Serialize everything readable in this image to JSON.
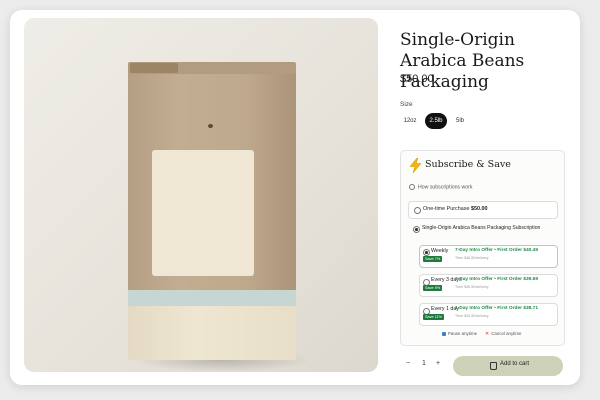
{
  "product": {
    "title": "Single-Origin Arabica Beans Packaging",
    "price": "$50.00"
  },
  "size": {
    "label": "Size",
    "options": [
      "12oz",
      "2.5lb",
      "5lb"
    ],
    "selected": "2.5lb"
  },
  "subscription": {
    "title": "Subscribe & Save",
    "how_link": "How subscriptions work",
    "one_time": {
      "label": "One-time Purchase",
      "price": "$50.00"
    },
    "subscribe_option": "Single-Origin Arabica Beans Packaging Subscription",
    "frequencies": [
      {
        "name": "Weekly",
        "badge": "Save 7%",
        "offer": "7-Day Intro Offer • First Order $40.45",
        "then": "Then $46.50/delivery",
        "selected": true
      },
      {
        "name": "Every 3 days",
        "badge": "Save 9%",
        "offer": "3-Day Intro Offer • First Order $39.59",
        "then": "Then $45.50/delivery",
        "selected": false
      },
      {
        "name": "Every 1 day",
        "badge": "Save 11%",
        "offer": "1-Day Intro Offer • First Order $38.71",
        "then": "Then $44.50/delivery",
        "selected": false
      }
    ],
    "pause": "Pause anytime",
    "cancel": "Cancel anytime"
  },
  "cart": {
    "minus": "−",
    "quantity": "1",
    "plus": "+",
    "add_label": "Add to cart"
  },
  "colors": {
    "accent_green": "#1f8a45",
    "cart_button": "#cdd2b8",
    "bag_kraft": "#bfa98d"
  },
  "icons": [
    "lightning-icon",
    "info-icon",
    "checkbox-icon",
    "close-icon",
    "shopping-bag-icon"
  ]
}
